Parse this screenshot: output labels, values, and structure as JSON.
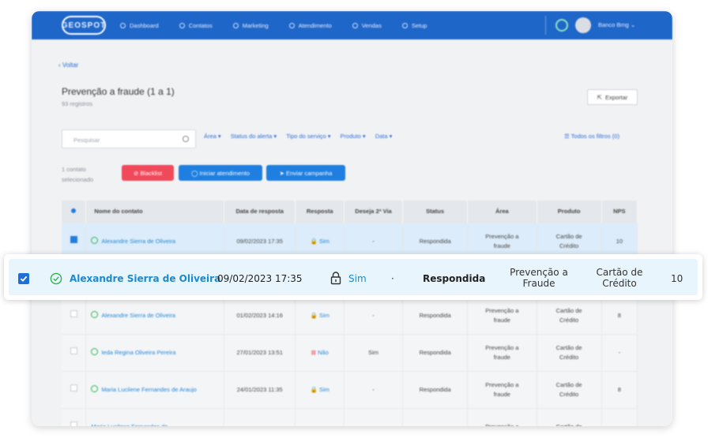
{
  "app": {
    "logo": "GEOSPOT",
    "nav": [
      "Dashboard",
      "Contatos",
      "Marketing",
      "Atendimento",
      "Vendas",
      "Setup"
    ],
    "user": "Banco Bmg"
  },
  "page": {
    "back": "Voltar",
    "title": "Prevenção a fraude (1 a 1)",
    "subtitle": "93 registros",
    "export": "Exportar"
  },
  "search": {
    "placeholder": "Pesquisar"
  },
  "filters": [
    "Área",
    "Status do alerta",
    "Tipo do serviço",
    "Produto",
    "Data"
  ],
  "all_filters": "Todos os filtros (0)",
  "selection": {
    "count_line1": "1 contato",
    "count_line2": "selecionado"
  },
  "actions": {
    "blacklist": "Blacklist",
    "start": "Iniciar atendimento",
    "campaign": "Enviar campanha"
  },
  "table": {
    "headers": [
      "Nome do contato",
      "Data de resposta",
      "Resposta",
      "Deseja 2ª Via",
      "Status",
      "Área",
      "Produto",
      "NPS"
    ],
    "rows": [
      {
        "name": "Alexandre Sierra de Oliveira",
        "date": "09/02/2023 17:35",
        "resp": "Sim",
        "via": "-",
        "status": "Respondida",
        "area1": "Prevenção a",
        "area2": "fraude",
        "prod1": "Cartão de",
        "prod2": "Crédito",
        "nps": "10"
      },
      {
        "name": "",
        "date": "",
        "resp": "",
        "via": "",
        "status": "",
        "area1": "",
        "area2": "",
        "prod1": "",
        "prod2": "",
        "nps": ""
      },
      {
        "name": "Alexandre Sierra de Oliveira",
        "date": "01/02/2023 14:16",
        "resp": "Sim",
        "via": "-",
        "status": "Respondida",
        "area1": "Prevenção a",
        "area2": "fraude",
        "prod1": "Cartão de",
        "prod2": "Crédito",
        "nps": "8"
      },
      {
        "name": "Ieda Regina Oliveira Pereira",
        "date": "27/01/2023 13:51",
        "resp": "Não",
        "via": "Sim",
        "status": "Respondida",
        "area1": "Prevenção a",
        "area2": "fraude",
        "prod1": "Cartão de",
        "prod2": "Crédito",
        "nps": "-"
      },
      {
        "name": "Maria Lucilene Fernandes de Araujo",
        "date": "24/01/2023 11:35",
        "resp": "Sim",
        "via": "-",
        "status": "Respondida",
        "area1": "Prevenção a",
        "area2": "fraude",
        "prod1": "Cartão de",
        "prod2": "Crédito",
        "nps": "8"
      },
      {
        "name": "Maria Lucilene Fernandes de",
        "date": "",
        "resp": "",
        "via": "",
        "status": "",
        "area1": "Prevenção a",
        "area2": "",
        "prod1": "Cartão de",
        "prod2": "",
        "nps": ""
      }
    ]
  },
  "highlight": {
    "name": "Alexandre Sierra de Oliveira",
    "date": "09/02/2023 17:35",
    "resp": "Sim",
    "via": "·",
    "status": "Respondida",
    "area1": "Prevenção a",
    "area2": "Fraude",
    "prod1": "Cartão de",
    "prod2": "Crédito",
    "nps": "10"
  },
  "colors": {
    "brand": "#1f66c9",
    "accent": "#1f7fe0",
    "danger": "#f0495a",
    "success": "#2eb34f"
  }
}
